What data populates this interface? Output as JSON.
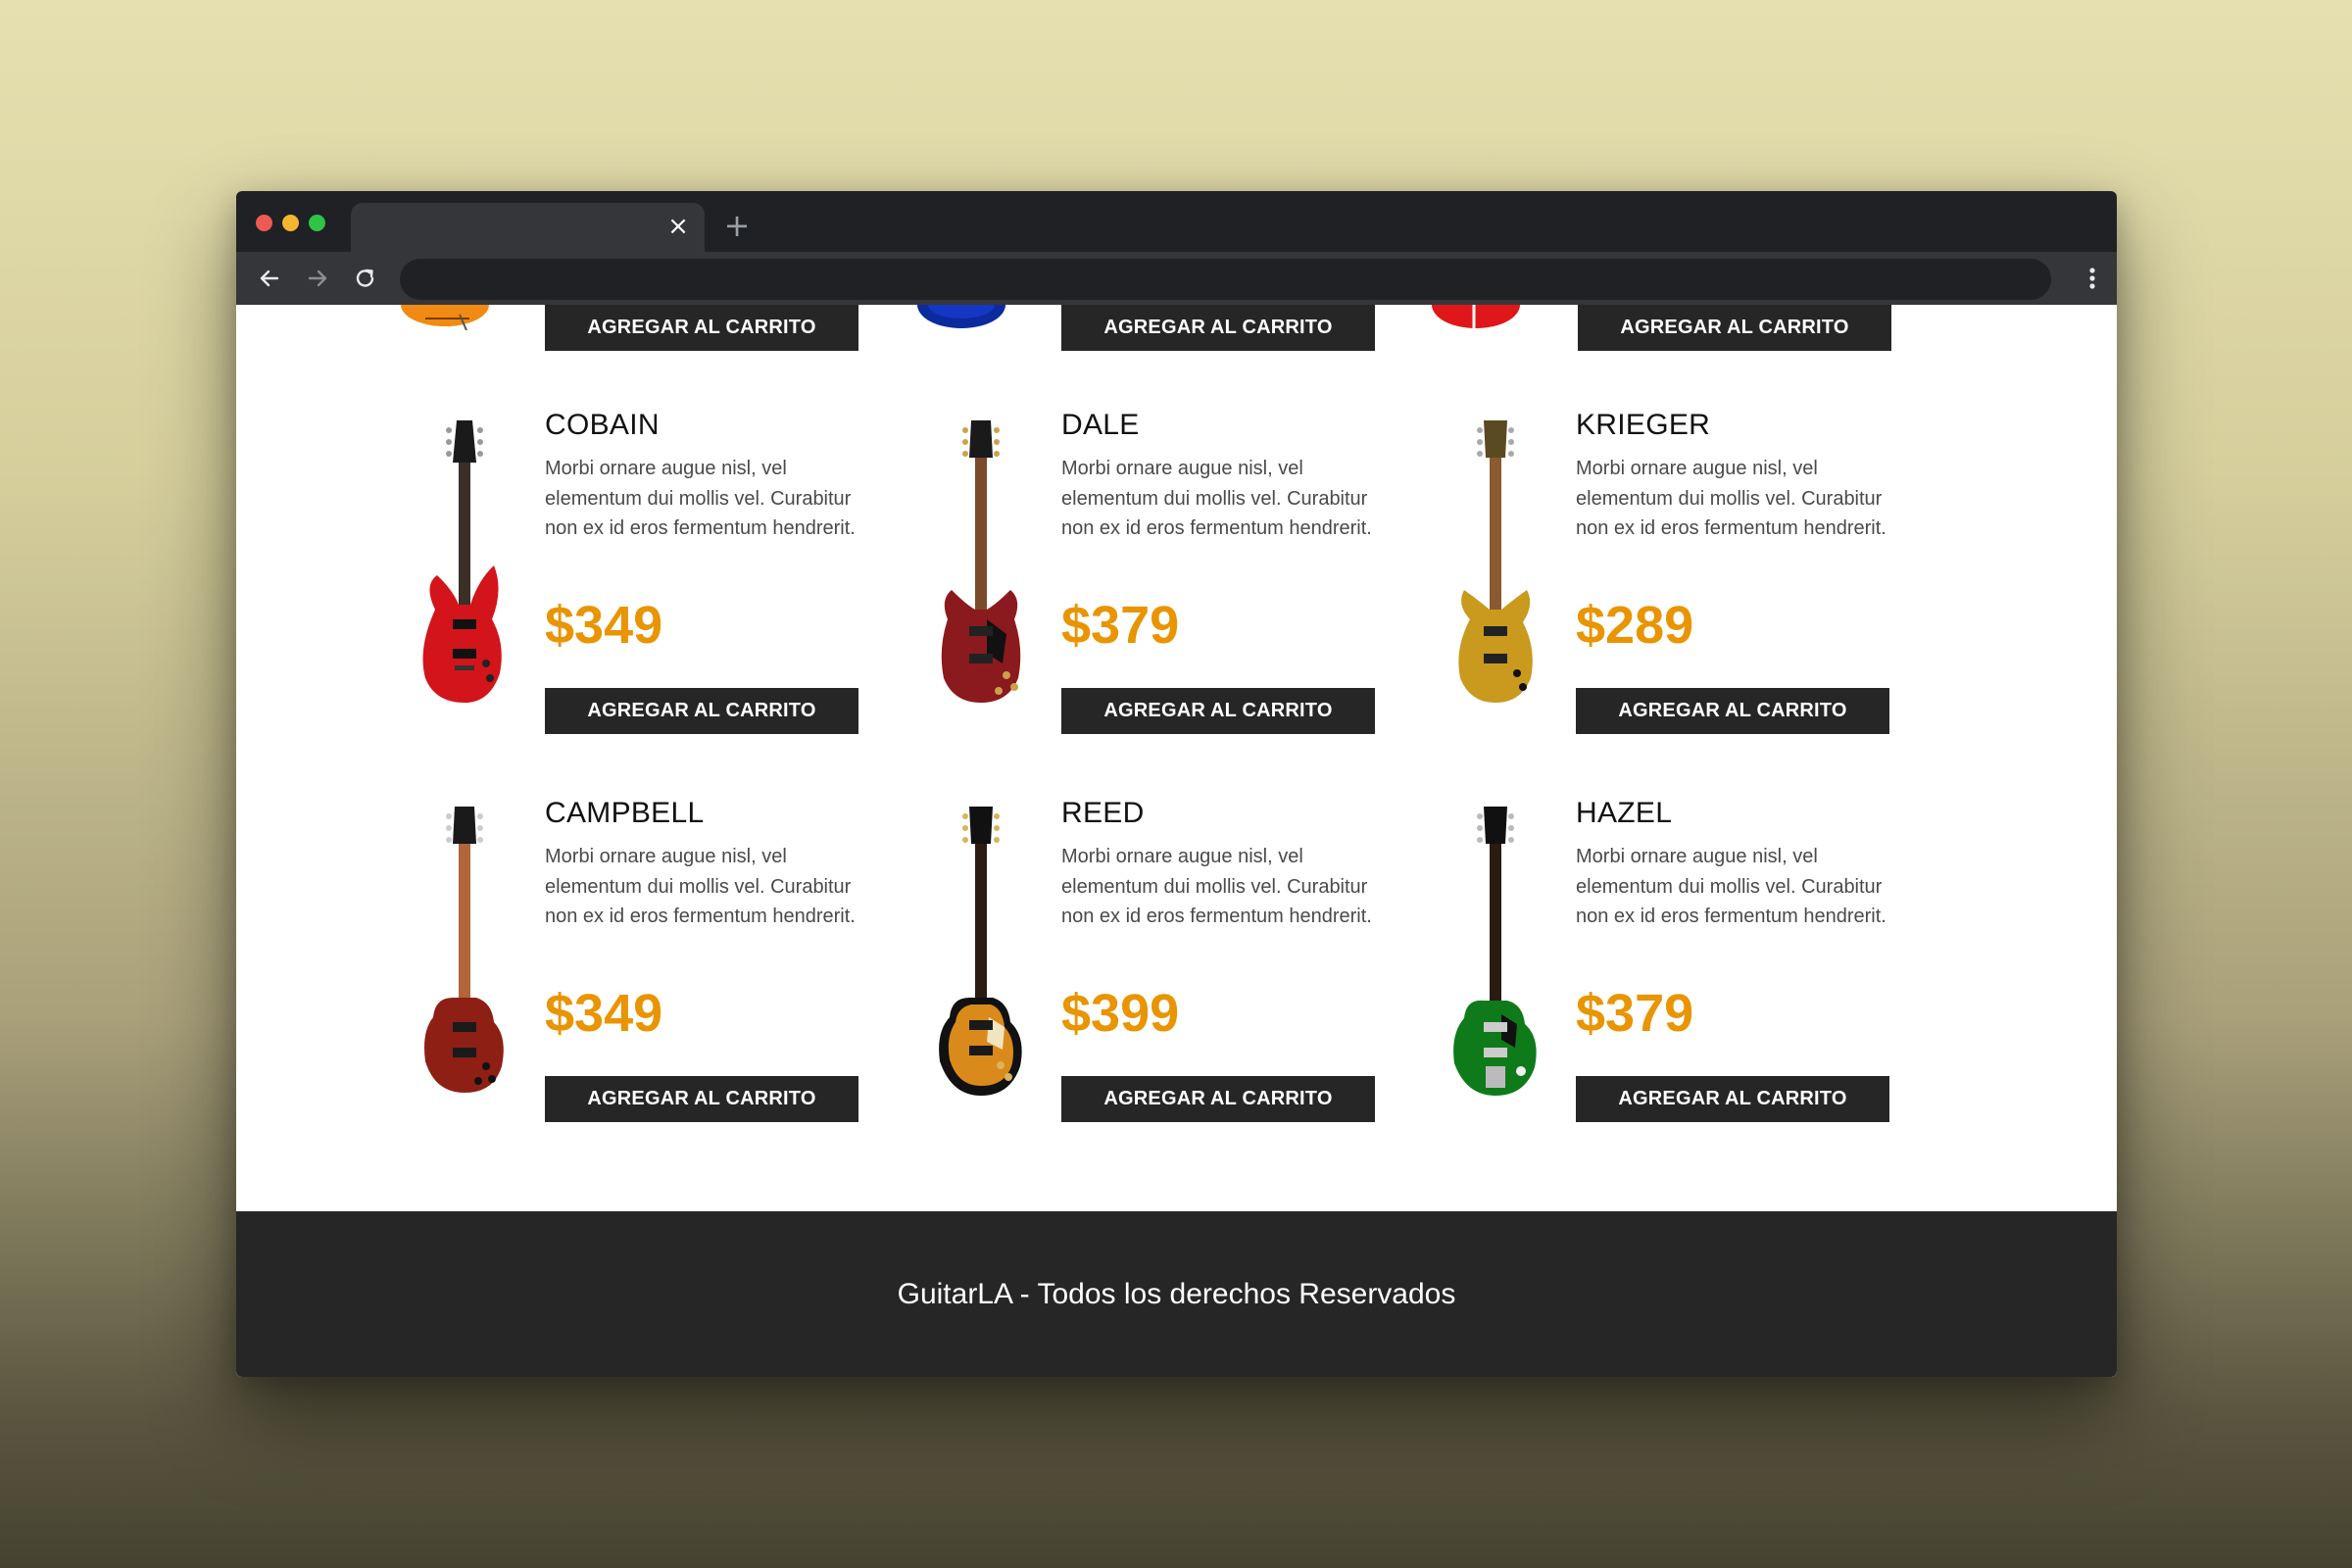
{
  "browser": {
    "tab_close": "×",
    "new_tab": "+"
  },
  "top_buttons": [
    "AGREGAR AL CARRITO",
    "AGREGAR AL CARRITO",
    "AGREGAR AL CARRITO"
  ],
  "products": [
    {
      "name": "COBAIN",
      "description": "Morbi ornare augue nisl, vel elementum dui mollis vel. Curabitur non ex id eros fermentum hendrerit.",
      "price": "$349",
      "button": "AGREGAR AL CARRITO",
      "icon": "red-electric-guitar"
    },
    {
      "name": "DALE",
      "description": "Morbi ornare augue nisl, vel elementum dui mollis vel. Curabitur non ex id eros fermentum hendrerit.",
      "price": "$379",
      "button": "AGREGAR AL CARRITO",
      "icon": "cherry-sg-guitar"
    },
    {
      "name": "KRIEGER",
      "description": "Morbi ornare augue nisl, vel elementum dui mollis vel. Curabitur non ex id eros fermentum hendrerit.",
      "price": "$289",
      "button": "AGREGAR AL CARRITO",
      "icon": "gold-electric-guitar"
    },
    {
      "name": "CAMPBELL",
      "description": "Morbi ornare augue nisl, vel elementum dui mollis vel. Curabitur non ex id eros fermentum hendrerit.",
      "price": "$349",
      "button": "AGREGAR AL CARRITO",
      "icon": "red-les-paul-guitar"
    },
    {
      "name": "REED",
      "description": "Morbi ornare augue nisl, vel elementum dui mollis vel. Curabitur non ex id eros fermentum hendrerit.",
      "price": "$399",
      "button": "AGREGAR AL CARRITO",
      "icon": "sunburst-les-paul-guitar"
    },
    {
      "name": "HAZEL",
      "description": "Morbi ornare augue nisl, vel elementum dui mollis vel. Curabitur non ex id eros fermentum hendrerit.",
      "price": "$379",
      "button": "AGREGAR AL CARRITO",
      "icon": "green-les-paul-guitar"
    }
  ],
  "footer": {
    "text": "GuitarLA - Todos los derechos Reservados"
  },
  "colors": {
    "price": "#e99401",
    "button_bg": "#262626",
    "footer_bg": "#262626"
  }
}
